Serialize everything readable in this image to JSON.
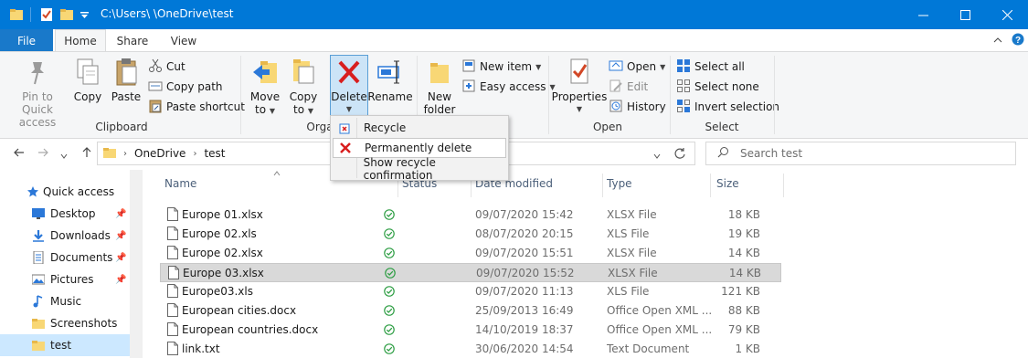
{
  "titlebar": {
    "path": "C:\\Users\\       \\OneDrive\\test",
    "controls": {
      "minimize": "—",
      "maximize": "☐",
      "close": "✕"
    }
  },
  "tabs": [
    {
      "label": "File"
    },
    {
      "label": "Home",
      "active": true
    },
    {
      "label": "Share"
    },
    {
      "label": "View"
    }
  ],
  "ribbon": {
    "clipboard": {
      "label": "Clipboard",
      "pin_line1": "Pin to Quick",
      "pin_line2": "access",
      "copy": "Copy",
      "paste": "Paste",
      "cut": "Cut",
      "copy_path": "Copy path",
      "paste_shortcut": "Paste shortcut"
    },
    "organize": {
      "label": "Orga",
      "move_to_1": "Move",
      "move_to_2": "to",
      "copy_to_1": "Copy",
      "copy_to_2": "to",
      "delete": "Delete",
      "rename": "Rename"
    },
    "new": {
      "new_folder_1": "New",
      "new_folder_2": "folder",
      "new_item": "New item",
      "easy_access": "Easy access"
    },
    "open": {
      "label": "Open",
      "properties": "Properties",
      "open": "Open",
      "edit": "Edit",
      "history": "History"
    },
    "select": {
      "label": "Select",
      "select_all": "Select all",
      "select_none": "Select none",
      "invert": "Invert selection"
    }
  },
  "delete_menu": [
    {
      "label": "Recycle",
      "icon": "recycle-icon"
    },
    {
      "label": "Permanently delete",
      "icon": "red-x-icon",
      "hover": true
    },
    {
      "label": "Show recycle confirmation",
      "icon": ""
    }
  ],
  "address": {
    "crumbs": [
      "OneDrive",
      "test"
    ],
    "search_placeholder": "Search test"
  },
  "sidebar": [
    {
      "label": "Quick access",
      "icon": "star-icon",
      "pinned": false
    },
    {
      "label": "Desktop",
      "icon": "desktop-icon",
      "pinned": true
    },
    {
      "label": "Downloads",
      "icon": "download-icon",
      "pinned": true
    },
    {
      "label": "Documents",
      "icon": "documents-icon",
      "pinned": true
    },
    {
      "label": "Pictures",
      "icon": "pictures-icon",
      "pinned": true
    },
    {
      "label": "Music",
      "icon": "music-icon",
      "pinned": false
    },
    {
      "label": "Screenshots",
      "icon": "folder-icon",
      "pinned": false
    },
    {
      "label": "test",
      "icon": "folder-icon",
      "pinned": false,
      "selected": true
    }
  ],
  "columns": {
    "name": "Name",
    "status": "Status",
    "date": "Date modified",
    "type": "Type",
    "size": "Size"
  },
  "files": [
    {
      "name": "Europe 01.xlsx",
      "date": "09/07/2020 15:42",
      "type": "XLSX File",
      "size": "18 KB"
    },
    {
      "name": "Europe 02.xls",
      "date": "08/07/2020 20:15",
      "type": "XLS File",
      "size": "19 KB"
    },
    {
      "name": "Europe 02.xlsx",
      "date": "09/07/2020 15:51",
      "type": "XLSX File",
      "size": "14 KB"
    },
    {
      "name": "Europe 03.xlsx",
      "date": "09/07/2020 15:52",
      "type": "XLSX File",
      "size": "14 KB",
      "selected": true
    },
    {
      "name": "Europe03.xls",
      "date": "09/07/2020 11:13",
      "type": "XLS File",
      "size": "121 KB"
    },
    {
      "name": "European cities.docx",
      "date": "25/09/2013 16:49",
      "type": "Office Open XML ...",
      "size": "88 KB"
    },
    {
      "name": "European countries.docx",
      "date": "14/10/2019 18:37",
      "type": "Office Open XML ...",
      "size": "79 KB"
    },
    {
      "name": "link.txt",
      "date": "30/06/2020 14:54",
      "type": "Text Document",
      "size": "1 KB"
    }
  ],
  "colors": {
    "titlebar": "#0078d7",
    "status_ok": "#2e9e44",
    "delete_red": "#d81e1e",
    "selection": "#cce8ff"
  }
}
